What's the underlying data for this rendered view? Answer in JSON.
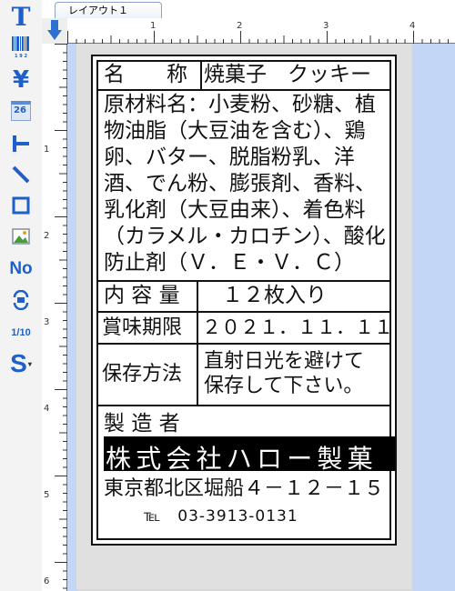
{
  "toolbar": {
    "text_icon": "T",
    "barcode_caption": "1 9 2",
    "yen_icon": "¥",
    "calendar_num": "26",
    "numbering_icon": "No",
    "fraction_icon": "1/10",
    "s_icon": "S"
  },
  "tab": {
    "label": "レイアウト１"
  },
  "ruler": {
    "h_marks": [
      "1",
      "2",
      "3",
      "4"
    ],
    "v_marks": [
      "1",
      "2",
      "3",
      "4",
      "5",
      "6"
    ]
  },
  "label": {
    "name_heading": "名　　称",
    "name_value": "焼菓子　クッキー",
    "ingredients": "原材料名：小麦粉、砂糖、植物油脂（大豆油を含む）、鶏卵、バター、脱脂粉乳、洋酒、でん粉、膨張剤、香料、乳化剤（大豆由来）、着色料（カラメル・カロチン）、酸化防止剤（Ｖ．Ｅ・Ｖ．Ｃ）",
    "content_heading": "内 容 量",
    "content_value": "１２枚入り",
    "bestbefore_heading": "賞味期限",
    "bestbefore_value": "２０２１．１１．１１",
    "storage_heading": "保存方法",
    "storage_value_1": "直射日光を避けて",
    "storage_value_2": "保存して下さい。",
    "maker_heading": "製 造 者",
    "maker_name": "株式会社ハロー製菓",
    "maker_address": "東京都北区堀船４－１２－１５",
    "maker_tel": "℡　03-3913-0131"
  }
}
